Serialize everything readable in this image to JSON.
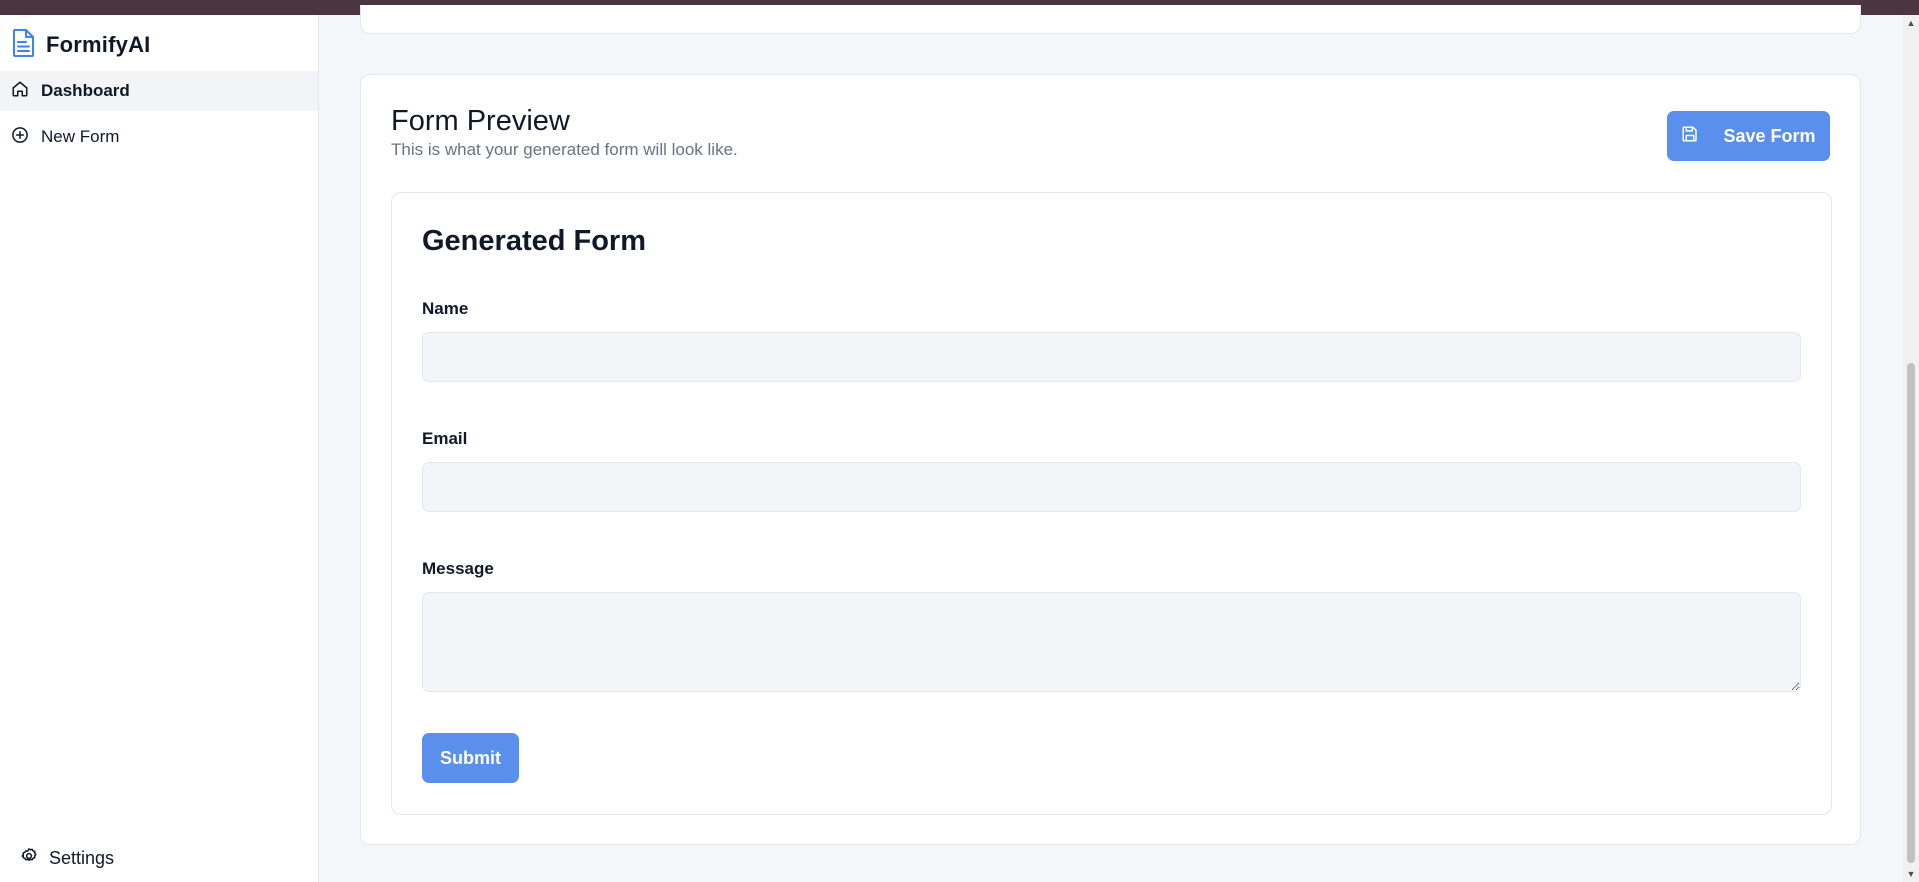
{
  "app": {
    "name": "FormifyAI"
  },
  "sidebar": {
    "items": [
      {
        "label": "Dashboard",
        "icon": "home-icon",
        "active": true
      },
      {
        "label": "New Form",
        "icon": "plus-circle-icon",
        "active": false
      }
    ],
    "settings": {
      "label": "Settings",
      "icon": "gear-icon"
    }
  },
  "preview": {
    "title": "Form Preview",
    "subtitle": "This is what your generated form will look like.",
    "save_label": "Save Form"
  },
  "form": {
    "title": "Generated Form",
    "fields": [
      {
        "label": "Name",
        "value": "",
        "type": "text"
      },
      {
        "label": "Email",
        "value": "",
        "type": "text"
      },
      {
        "label": "Message",
        "value": "",
        "type": "textarea"
      }
    ],
    "submit_label": "Submit"
  },
  "colors": {
    "accent": "#5b8fed",
    "topbar": "#4a3540",
    "brand_icon": "#3b82f6"
  }
}
